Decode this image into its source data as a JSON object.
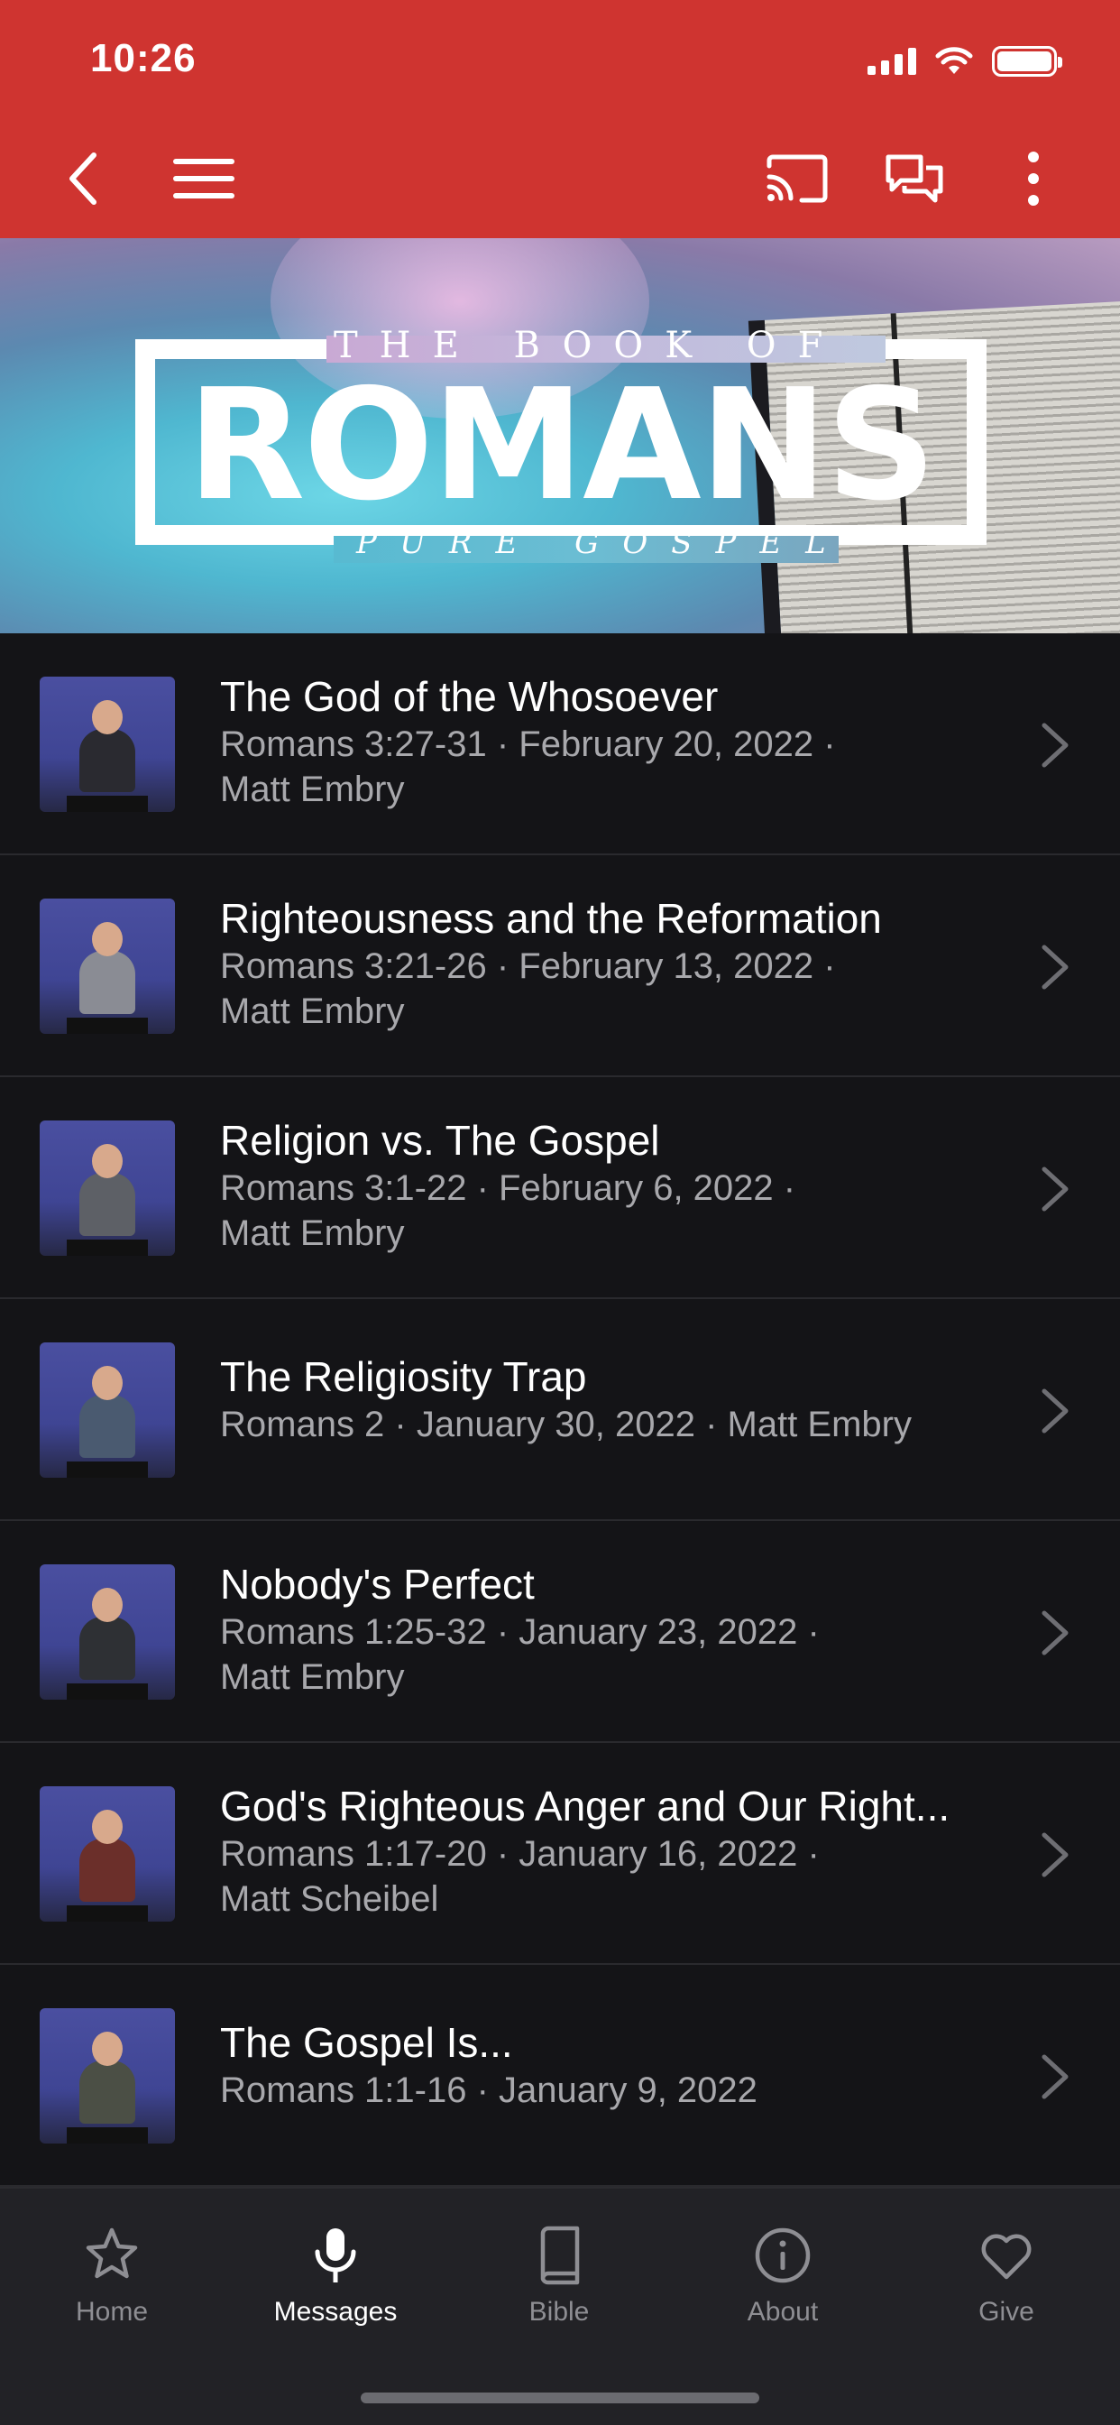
{
  "status_bar": {
    "time": "10:26"
  },
  "banner": {
    "line1": "THE BOOK OF",
    "title": "ROMANS",
    "tagline": "PURE GOSPEL"
  },
  "messages": [
    {
      "title": "The God of the Whosoever",
      "line1": "Romans 3:27-31 · February 20, 2022 ·",
      "line2": "Matt Embry"
    },
    {
      "title": "Righteousness and the Reformation",
      "line1": "Romans 3:21-26 · February 13, 2022 ·",
      "line2": "Matt Embry"
    },
    {
      "title": "Religion vs. The Gospel",
      "line1": "Romans 3:1-22 · February 6, 2022 ·",
      "line2": "Matt Embry"
    },
    {
      "title": "The Religiosity Trap",
      "line1": "Romans 2 · January 30, 2022 · Matt Embry",
      "line2": ""
    },
    {
      "title": "Nobody's Perfect",
      "line1": "Romans 1:25-32 · January 23, 2022 ·",
      "line2": "Matt Embry"
    },
    {
      "title": "God's Righteous Anger and Our Right...",
      "line1": "Romans 1:17-20 · January 16, 2022 ·",
      "line2": "Matt Scheibel"
    },
    {
      "title": "The Gospel Is...",
      "line1": "Romans 1:1-16 · January 9, 2022",
      "line2": ""
    }
  ],
  "tabs": [
    {
      "label": "Home",
      "icon": "star-icon",
      "active": false
    },
    {
      "label": "Messages",
      "icon": "microphone-icon",
      "active": true
    },
    {
      "label": "Bible",
      "icon": "book-icon",
      "active": false
    },
    {
      "label": "About",
      "icon": "info-icon",
      "active": false
    },
    {
      "label": "Give",
      "icon": "heart-icon",
      "active": false
    }
  ],
  "colors": {
    "header": "#cf3430",
    "background": "#141417",
    "tabbar": "#222226",
    "muted_text": "#a8a8ac"
  }
}
